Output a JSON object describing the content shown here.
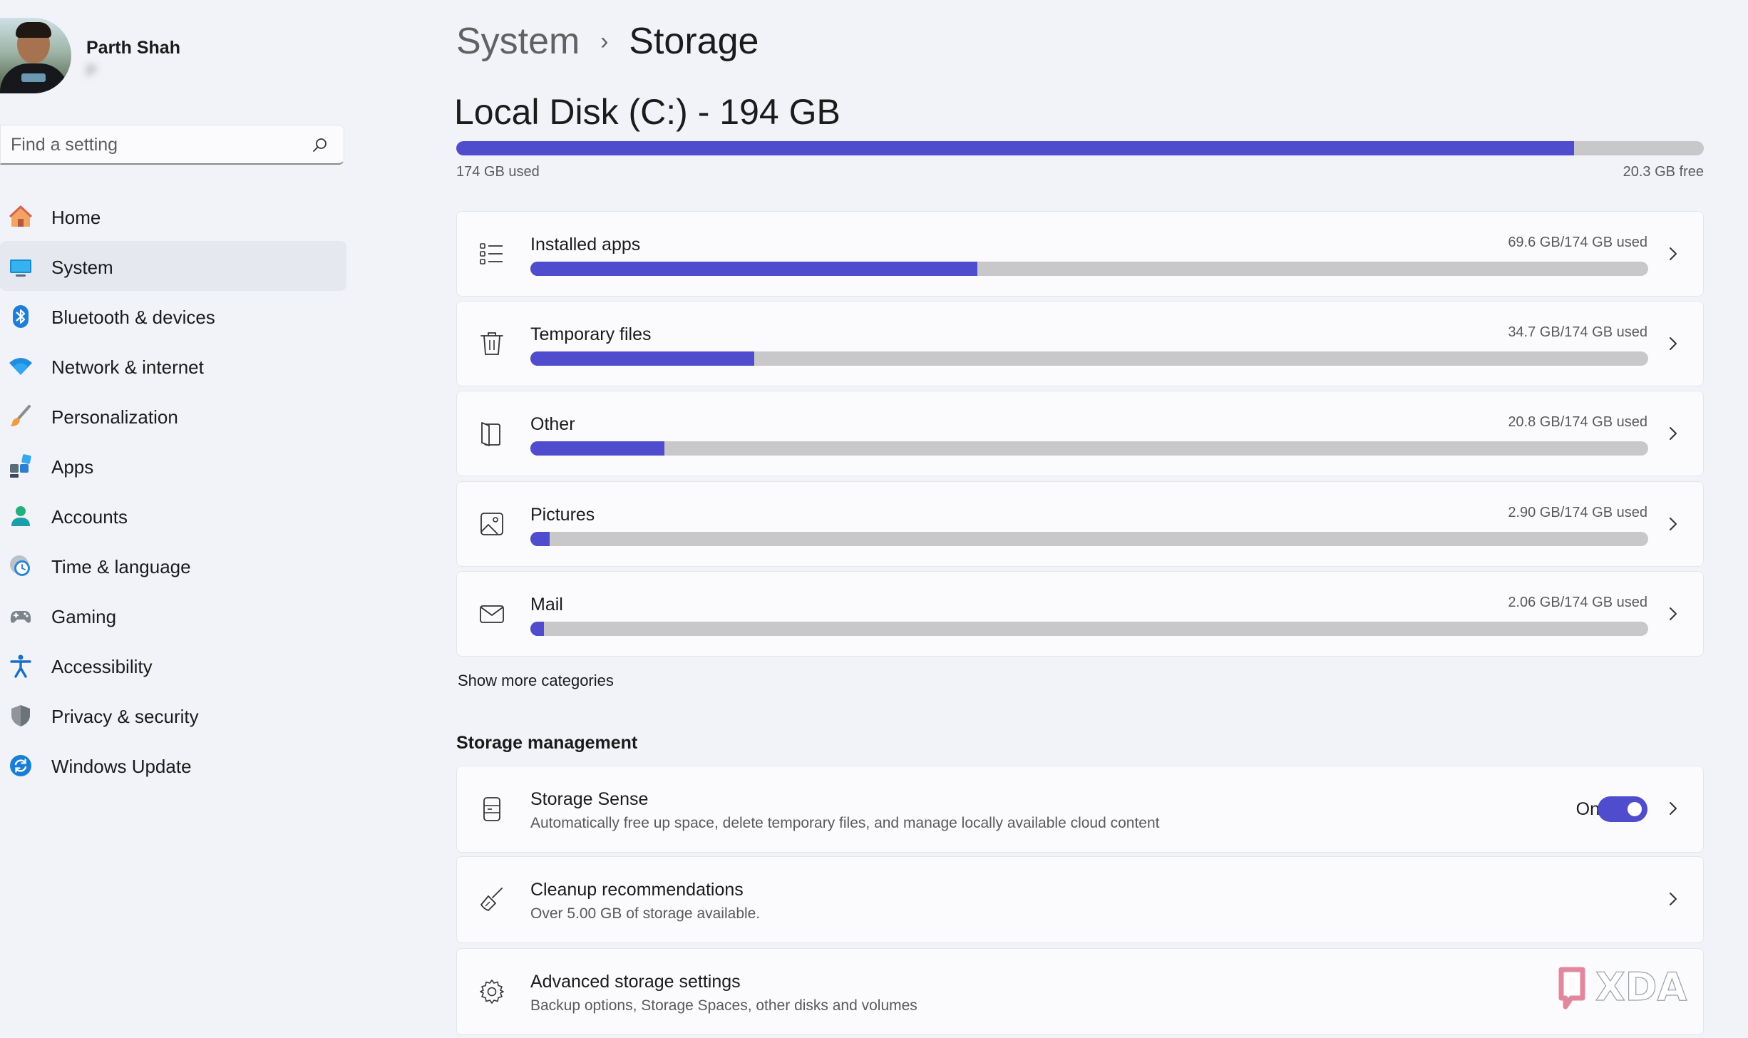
{
  "profile": {
    "name": "Parth Shah",
    "email": "P"
  },
  "search": {
    "placeholder": "Find a setting"
  },
  "nav": {
    "items": [
      {
        "label": "Home",
        "icon": "home-icon"
      },
      {
        "label": "System",
        "icon": "system-icon",
        "active": true
      },
      {
        "label": "Bluetooth & devices",
        "icon": "bluetooth-icon"
      },
      {
        "label": "Network & internet",
        "icon": "wifi-icon"
      },
      {
        "label": "Personalization",
        "icon": "brush-icon"
      },
      {
        "label": "Apps",
        "icon": "apps-icon"
      },
      {
        "label": "Accounts",
        "icon": "person-icon"
      },
      {
        "label": "Time & language",
        "icon": "clock-globe-icon"
      },
      {
        "label": "Gaming",
        "icon": "gamepad-icon"
      },
      {
        "label": "Accessibility",
        "icon": "accessibility-icon"
      },
      {
        "label": "Privacy & security",
        "icon": "shield-icon"
      },
      {
        "label": "Windows Update",
        "icon": "update-icon"
      }
    ]
  },
  "breadcrumb": {
    "parent": "System",
    "separator": "›",
    "current": "Storage"
  },
  "disk": {
    "title": "Local Disk (C:) - 194 GB",
    "used_label": "174 GB used",
    "free_label": "20.3 GB free",
    "used_fraction": 0.896
  },
  "categories": [
    {
      "title": "Installed apps",
      "usage": "69.6 GB/174 GB used",
      "fraction": 0.4,
      "icon": "list-icon"
    },
    {
      "title": "Temporary files",
      "usage": "34.7 GB/174 GB used",
      "fraction": 0.2,
      "icon": "trash-icon"
    },
    {
      "title": "Other",
      "usage": "20.8 GB/174 GB used",
      "fraction": 0.12,
      "icon": "document-icon"
    },
    {
      "title": "Pictures",
      "usage": "2.90 GB/174 GB used",
      "fraction": 0.017,
      "icon": "picture-icon"
    },
    {
      "title": "Mail",
      "usage": "2.06 GB/174 GB used",
      "fraction": 0.012,
      "icon": "mail-icon"
    }
  ],
  "show_more": "Show more categories",
  "management": {
    "title": "Storage management",
    "items": [
      {
        "title": "Storage Sense",
        "desc": "Automatically free up space, delete temporary files, and manage locally available cloud content",
        "toggle_label": "On",
        "toggle_on": true,
        "icon": "drive-icon"
      },
      {
        "title": "Cleanup recommendations",
        "desc": "Over 5.00 GB of storage available.",
        "icon": "broom-icon"
      },
      {
        "title": "Advanced storage settings",
        "desc": "Backup options, Storage Spaces, other disks and volumes",
        "icon": "gear-icon"
      }
    ]
  },
  "watermark": "XDA",
  "colors": {
    "accent": "#4f4ccd",
    "track": "#c8c8cb",
    "background": "#f1f3f9",
    "card": "#fbfbfd"
  }
}
